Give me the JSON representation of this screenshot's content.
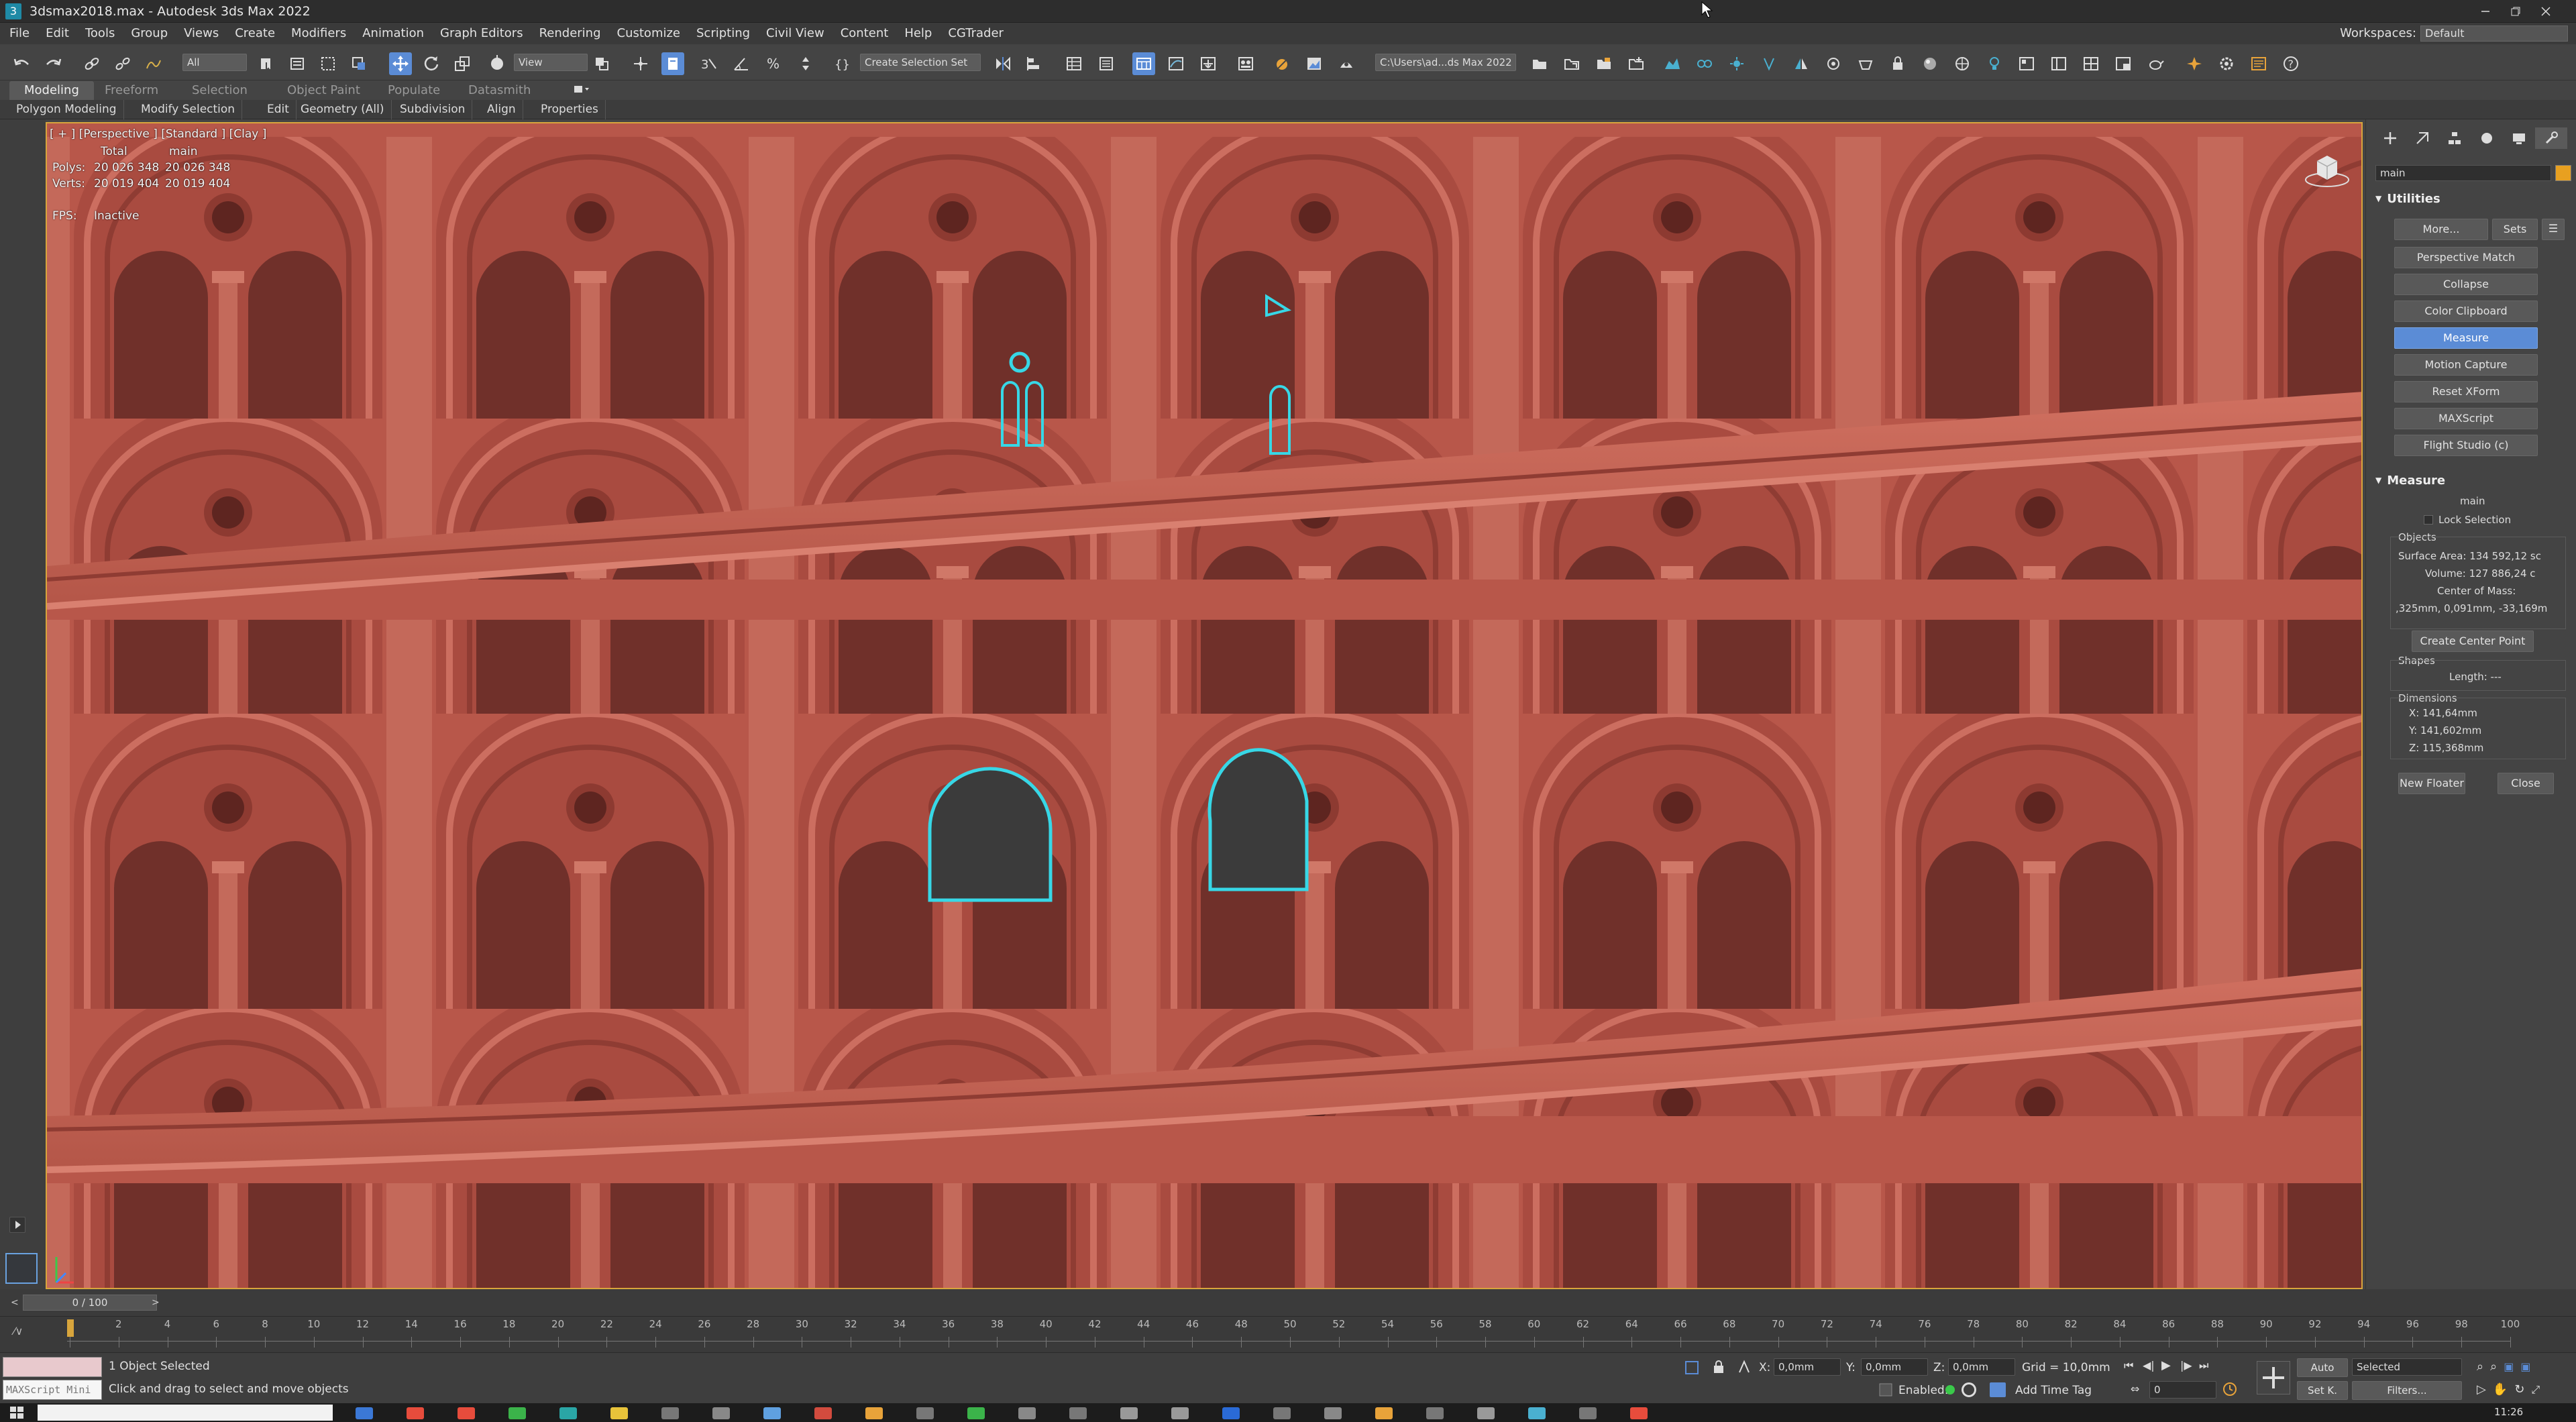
{
  "window": {
    "title": "3dsmax2018.max - Autodesk 3ds Max 2022",
    "workspaces_label": "Workspaces:",
    "workspace_value": "Default"
  },
  "menu": [
    "File",
    "Edit",
    "Tools",
    "Group",
    "Views",
    "Create",
    "Modifiers",
    "Animation",
    "Graph Editors",
    "Rendering",
    "Customize",
    "Scripting",
    "Civil View",
    "Content",
    "Help",
    "CGTrader"
  ],
  "toolbar": {
    "filter": "All",
    "view": "View",
    "selection_set": "Create Selection Set",
    "project_path": "C:\\Users\\ad...ds Max 2022"
  },
  "ribbon": {
    "tabs": [
      "Modeling",
      "Freeform",
      "Selection",
      "Object Paint",
      "Populate",
      "Datasmith"
    ],
    "items": [
      "Polygon Modeling",
      "Modify Selection",
      "Edit",
      "Geometry (All)",
      "Subdivision",
      "Align",
      "Properties"
    ]
  },
  "viewport": {
    "label": "[ + ] [Perspective ] [Standard ] [Clay ]",
    "stats_head_total": "Total",
    "stats_head_main": "main",
    "polys_label": "Polys:",
    "polys_total": "20 026 348",
    "polys_main": "20 026 348",
    "verts_label": "Verts:",
    "verts_total": "20 019 404",
    "verts_main": "20 019 404",
    "fps_label": "FPS:",
    "fps_value": "Inactive"
  },
  "cmd": {
    "object_name": "main",
    "utilities_title": "Utilities",
    "more": "More...",
    "sets": "Sets",
    "utilities": [
      "Perspective Match",
      "Collapse",
      "Color Clipboard",
      "Measure",
      "Motion Capture",
      "Reset XForm",
      "MAXScript",
      "Flight Studio (c)"
    ],
    "selected_utility": "Measure",
    "measure_title": "Measure",
    "measure_object": "main",
    "lock_selection": "Lock Selection",
    "objects_label": "Objects",
    "surface_area": "Surface Area: 134 592,12 sc",
    "volume": "Volume: 127 886,24 c",
    "center_of_mass_label": "Center of Mass:",
    "center_of_mass": ",325mm, 0,091mm, -33,169m",
    "create_center_point": "Create Center Point",
    "shapes_label": "Shapes",
    "length": "Length: ---",
    "dimensions_label": "Dimensions",
    "dim_x": "X:  141,64mm",
    "dim_y": "Y:  141,602mm",
    "dim_z": "Z:  115,368mm",
    "new_floater": "New Floater",
    "close": "Close"
  },
  "timeline": {
    "frame": "0 / 100",
    "ticks": [
      "0",
      "2",
      "4",
      "6",
      "8",
      "10",
      "12",
      "14",
      "16",
      "18",
      "20",
      "22",
      "24",
      "26",
      "28",
      "30",
      "32",
      "34",
      "36",
      "38",
      "40",
      "42",
      "44",
      "46",
      "48",
      "50",
      "52",
      "54",
      "56",
      "58",
      "60",
      "62",
      "64",
      "66",
      "68",
      "70",
      "72",
      "74",
      "76",
      "78",
      "80",
      "82",
      "84",
      "86",
      "88",
      "90",
      "92",
      "94",
      "96",
      "98",
      "100"
    ]
  },
  "status": {
    "maxscript": "MAXScript Mini",
    "selected": "1 Object Selected",
    "hint": "Click and drag to select and move objects",
    "x_label": "X:",
    "x_value": "0,0mm",
    "y_label": "Y:",
    "y_value": "0,0mm",
    "z_label": "Z:",
    "z_value": "0,0mm",
    "grid": "Grid = 10,0mm",
    "enabled": "Enabled:",
    "add_time_tag": "Add Time Tag",
    "auto": "Auto",
    "selected_dd": "Selected",
    "setk": "Set K.",
    "filters": "Filters...",
    "frame_field": "0",
    "clock": "11:26"
  },
  "colors": {
    "accent": "#5b8cd6",
    "viewport_border": "#d8a53c",
    "clay": "#b8574a",
    "selection": "#37d7e6"
  }
}
